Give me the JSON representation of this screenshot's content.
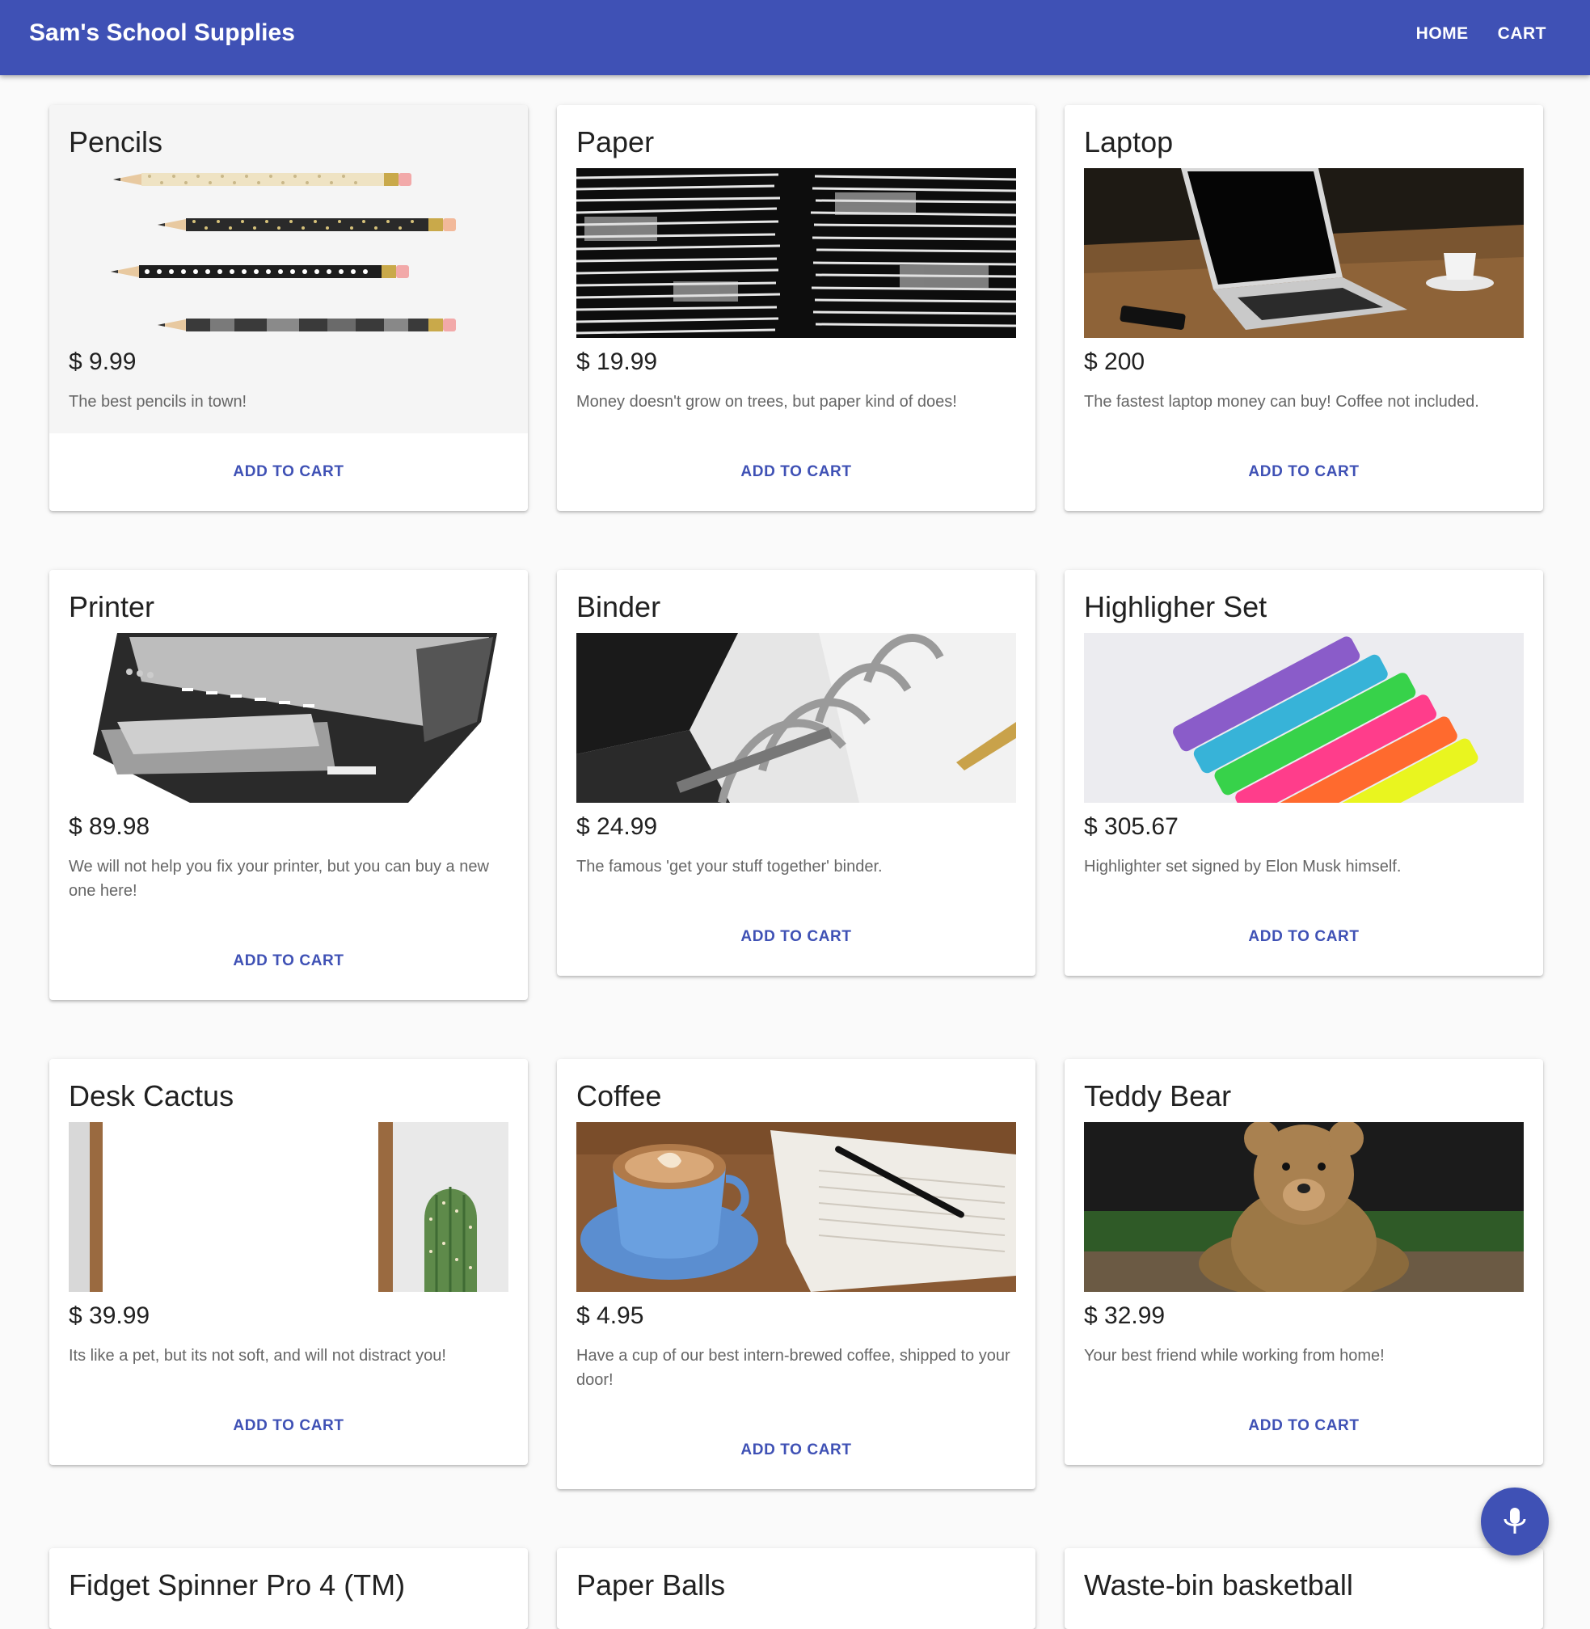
{
  "header": {
    "title": "Sam's School Supplies",
    "nav": [
      "HOME",
      "CART"
    ]
  },
  "products": [
    {
      "name": "Pencils",
      "price": "$ 9.99",
      "desc": "The best pencils in town!",
      "action": "ADD TO CART",
      "image": "pencils"
    },
    {
      "name": "Paper",
      "price": "$ 19.99",
      "desc": "Money doesn't grow on trees, but paper kind of does!",
      "action": "ADD TO CART",
      "image": "paper-stacks"
    },
    {
      "name": "Laptop",
      "price": "$ 200",
      "desc": "The fastest laptop money can buy! Coffee not included.",
      "action": "ADD TO CART",
      "image": "laptop-on-desk"
    },
    {
      "name": "Printer",
      "price": "$ 89.98",
      "desc": "We will not help you fix your printer, but you can buy a new one here!",
      "action": "ADD TO CART",
      "image": "printer"
    },
    {
      "name": "Binder",
      "price": "$ 24.99",
      "desc": "The famous 'get your stuff together' binder.",
      "action": "ADD TO CART",
      "image": "binder-rings"
    },
    {
      "name": "Highligher Set",
      "price": "$ 305.67",
      "desc": "Highlighter set signed by Elon Musk himself.",
      "action": "ADD TO CART",
      "image": "highlighter-markers"
    },
    {
      "name": "Desk Cactus",
      "price": "$ 39.99",
      "desc": "Its like a pet, but its not soft, and will not distract you!",
      "action": "ADD TO CART",
      "image": "cactus"
    },
    {
      "name": "Coffee",
      "price": "$ 4.95",
      "desc": "Have a cup of our best intern-brewed coffee, shipped to your door!",
      "action": "ADD TO CART",
      "image": "coffee-cup"
    },
    {
      "name": "Teddy Bear",
      "price": "$ 32.99",
      "desc": "Your best friend while working from home!",
      "action": "ADD TO CART",
      "image": "teddy-bear"
    },
    {
      "name": "Fidget Spinner Pro 4 (TM)"
    },
    {
      "name": "Paper Balls"
    },
    {
      "name": "Waste-bin basketball"
    }
  ],
  "fab": {
    "icon": "microphone-icon"
  },
  "colors": {
    "primary": "#3f51b5",
    "background": "#fafafa"
  }
}
